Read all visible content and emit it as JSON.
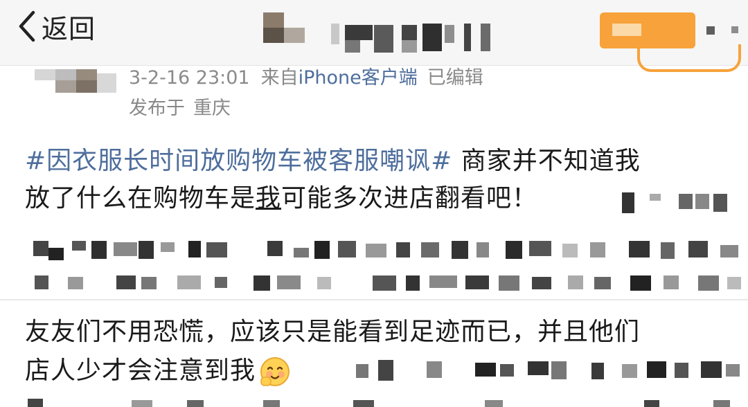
{
  "nav": {
    "back_label": "返回"
  },
  "post": {
    "time": "3-2-16 23:01",
    "source_prefix": "来自",
    "source_link": "iPhone客户端",
    "edited": "已编辑",
    "location_prefix": "发布于",
    "location": "重庆"
  },
  "body": {
    "hashtag": "#因衣服长时间放购物车被客服嘲讽#",
    "text_line1_rest": "商家并不知道我",
    "text_line2_pre": "放了什么在购物车是",
    "text_line2_underlined": "我",
    "text_line2_post": "可能多次进店翻看吧！",
    "text_line3": "友友们不用恐慌，应该只是能看到足迹而已，并且他们",
    "text_line4": "店人少才会注意到我"
  },
  "colors": {
    "accent_orange": "#f7a23a",
    "link_blue": "#4e6e9c",
    "meta_gray": "#888888"
  },
  "icons": {
    "back": "chevron-left-icon",
    "emoji": "smiling-face-emoji-icon"
  }
}
